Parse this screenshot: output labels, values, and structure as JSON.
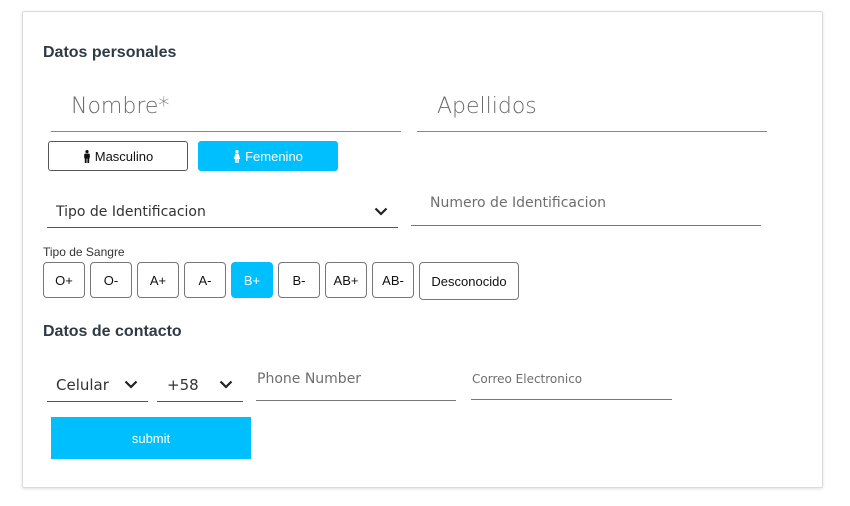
{
  "personal": {
    "title": "Datos personales",
    "nombre_placeholder": "Nombre*",
    "apellidos_placeholder": "Apellidos",
    "gender": {
      "male_label": "Masculino",
      "female_label": "Femenino",
      "selected": "Femenino"
    },
    "id_type_selected": "Tipo de Identificacion",
    "id_number_placeholder": "Numero de Identificacion",
    "blood_type_label": "Tipo de Sangre",
    "blood_types": [
      "O+",
      "O-",
      "A+",
      "A-",
      "B+",
      "B-",
      "AB+",
      "AB-",
      "Desconocido"
    ],
    "blood_type_selected": "B+"
  },
  "contact": {
    "title": "Datos de contacto",
    "phone_type_selected": "Celular",
    "country_code_selected": "+58",
    "phone_placeholder": "Phone Number",
    "email_placeholder": "Correo Electronico"
  },
  "submit_label": "submit",
  "colors": {
    "accent": "#00bfff",
    "heading": "#2f3a45",
    "border": "#777777"
  },
  "icons": {
    "male": "male-person-icon",
    "female": "female-person-icon",
    "dropdown": "chevron-down-icon"
  }
}
